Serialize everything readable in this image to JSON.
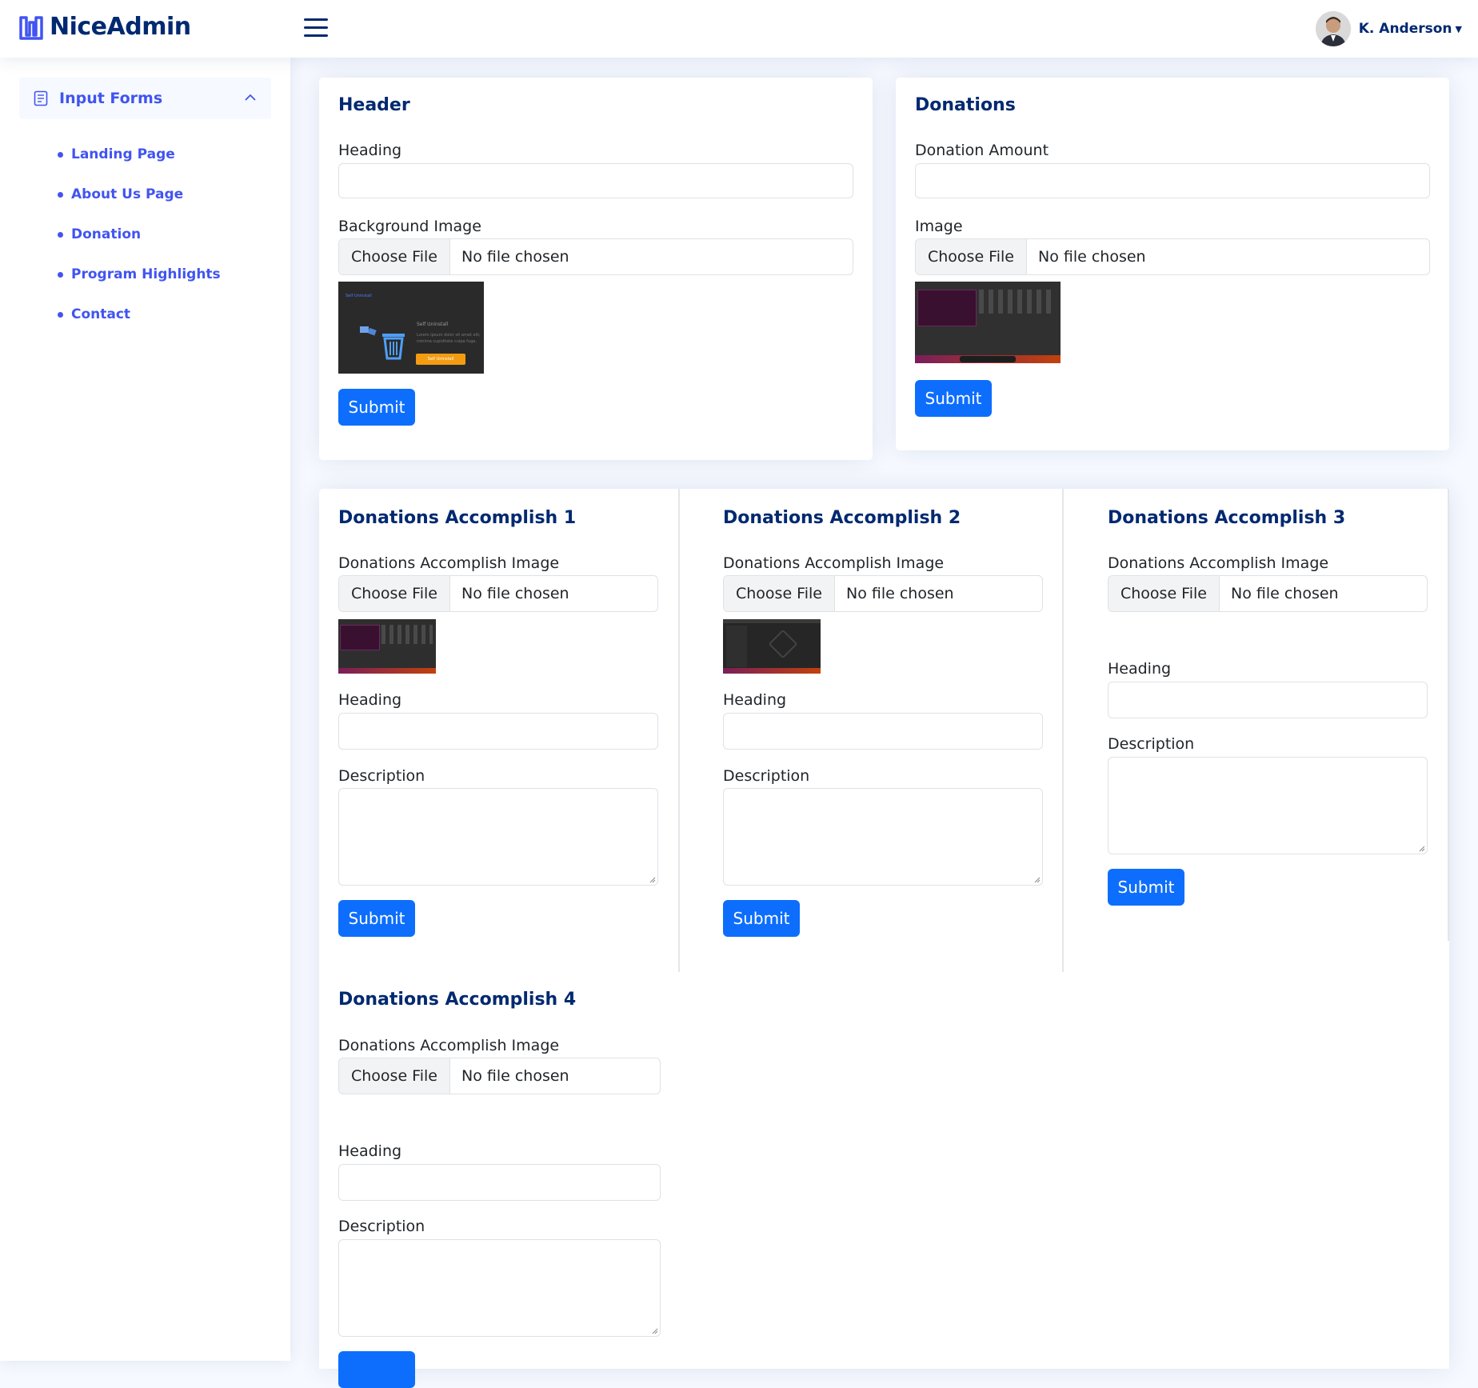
{
  "app": {
    "name": "NiceAdmin"
  },
  "user": {
    "name": "K. Anderson"
  },
  "sidebar": {
    "section_label": "Input Forms",
    "items": [
      {
        "label": "Landing Page"
      },
      {
        "label": "About Us Page"
      },
      {
        "label": "Donation"
      },
      {
        "label": "Program Highlights"
      },
      {
        "label": "Contact"
      }
    ]
  },
  "file_input": {
    "button_label": "Choose File",
    "status": "No file chosen"
  },
  "header_card": {
    "title": "Header",
    "heading_label": "Heading",
    "image_label": "Background Image",
    "submit_label": "Submit",
    "preview": {
      "top_text": "Self Uninstall",
      "heading": "Self Uninstall",
      "body": "Lorem ipsum dolor sit amet elit, minima cupiditate culpa fuga.",
      "button": "Self Uninstall"
    }
  },
  "donations_card": {
    "title": "Donations",
    "amount_label": "Donation Amount",
    "image_label": "Image",
    "submit_label": "Submit"
  },
  "accomplish": [
    {
      "title": "Donations Accomplish 1",
      "image_label": "Donations Accomplish Image",
      "heading_label": "Heading",
      "description_label": "Description",
      "submit_label": "Submit"
    },
    {
      "title": "Donations Accomplish 2",
      "image_label": "Donations Accomplish Image",
      "heading_label": "Heading",
      "description_label": "Description",
      "submit_label": "Submit"
    },
    {
      "title": "Donations Accomplish 3",
      "image_label": "Donations Accomplish Image",
      "heading_label": "Heading",
      "description_label": "Description",
      "submit_label": "Submit"
    },
    {
      "title": "Donations Accomplish 4",
      "image_label": "Donations Accomplish Image",
      "heading_label": "Heading",
      "description_label": "Description",
      "submit_label": ""
    }
  ],
  "colors": {
    "primary": "#0d6efd",
    "brand": "#012970",
    "accent": "#4154f1",
    "background": "#f6f9ff"
  },
  "icons": {
    "menu": "hamburger-icon",
    "nav": "document-icon",
    "collapse": "chevron-up-icon"
  }
}
